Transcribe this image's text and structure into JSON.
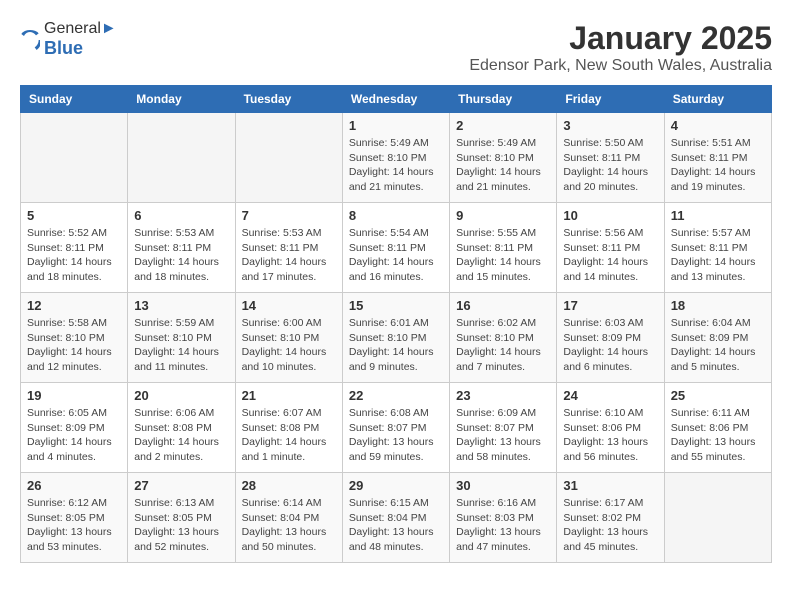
{
  "header": {
    "logo_general": "General",
    "logo_blue": "Blue",
    "month": "January 2025",
    "location": "Edensor Park, New South Wales, Australia"
  },
  "weekdays": [
    "Sunday",
    "Monday",
    "Tuesday",
    "Wednesday",
    "Thursday",
    "Friday",
    "Saturday"
  ],
  "weeks": [
    [
      {
        "day": "",
        "info": ""
      },
      {
        "day": "",
        "info": ""
      },
      {
        "day": "",
        "info": ""
      },
      {
        "day": "1",
        "info": "Sunrise: 5:49 AM\nSunset: 8:10 PM\nDaylight: 14 hours and 21 minutes."
      },
      {
        "day": "2",
        "info": "Sunrise: 5:49 AM\nSunset: 8:10 PM\nDaylight: 14 hours and 21 minutes."
      },
      {
        "day": "3",
        "info": "Sunrise: 5:50 AM\nSunset: 8:11 PM\nDaylight: 14 hours and 20 minutes."
      },
      {
        "day": "4",
        "info": "Sunrise: 5:51 AM\nSunset: 8:11 PM\nDaylight: 14 hours and 19 minutes."
      }
    ],
    [
      {
        "day": "5",
        "info": "Sunrise: 5:52 AM\nSunset: 8:11 PM\nDaylight: 14 hours and 18 minutes."
      },
      {
        "day": "6",
        "info": "Sunrise: 5:53 AM\nSunset: 8:11 PM\nDaylight: 14 hours and 18 minutes."
      },
      {
        "day": "7",
        "info": "Sunrise: 5:53 AM\nSunset: 8:11 PM\nDaylight: 14 hours and 17 minutes."
      },
      {
        "day": "8",
        "info": "Sunrise: 5:54 AM\nSunset: 8:11 PM\nDaylight: 14 hours and 16 minutes."
      },
      {
        "day": "9",
        "info": "Sunrise: 5:55 AM\nSunset: 8:11 PM\nDaylight: 14 hours and 15 minutes."
      },
      {
        "day": "10",
        "info": "Sunrise: 5:56 AM\nSunset: 8:11 PM\nDaylight: 14 hours and 14 minutes."
      },
      {
        "day": "11",
        "info": "Sunrise: 5:57 AM\nSunset: 8:11 PM\nDaylight: 14 hours and 13 minutes."
      }
    ],
    [
      {
        "day": "12",
        "info": "Sunrise: 5:58 AM\nSunset: 8:10 PM\nDaylight: 14 hours and 12 minutes."
      },
      {
        "day": "13",
        "info": "Sunrise: 5:59 AM\nSunset: 8:10 PM\nDaylight: 14 hours and 11 minutes."
      },
      {
        "day": "14",
        "info": "Sunrise: 6:00 AM\nSunset: 8:10 PM\nDaylight: 14 hours and 10 minutes."
      },
      {
        "day": "15",
        "info": "Sunrise: 6:01 AM\nSunset: 8:10 PM\nDaylight: 14 hours and 9 minutes."
      },
      {
        "day": "16",
        "info": "Sunrise: 6:02 AM\nSunset: 8:10 PM\nDaylight: 14 hours and 7 minutes."
      },
      {
        "day": "17",
        "info": "Sunrise: 6:03 AM\nSunset: 8:09 PM\nDaylight: 14 hours and 6 minutes."
      },
      {
        "day": "18",
        "info": "Sunrise: 6:04 AM\nSunset: 8:09 PM\nDaylight: 14 hours and 5 minutes."
      }
    ],
    [
      {
        "day": "19",
        "info": "Sunrise: 6:05 AM\nSunset: 8:09 PM\nDaylight: 14 hours and 4 minutes."
      },
      {
        "day": "20",
        "info": "Sunrise: 6:06 AM\nSunset: 8:08 PM\nDaylight: 14 hours and 2 minutes."
      },
      {
        "day": "21",
        "info": "Sunrise: 6:07 AM\nSunset: 8:08 PM\nDaylight: 14 hours and 1 minute."
      },
      {
        "day": "22",
        "info": "Sunrise: 6:08 AM\nSunset: 8:07 PM\nDaylight: 13 hours and 59 minutes."
      },
      {
        "day": "23",
        "info": "Sunrise: 6:09 AM\nSunset: 8:07 PM\nDaylight: 13 hours and 58 minutes."
      },
      {
        "day": "24",
        "info": "Sunrise: 6:10 AM\nSunset: 8:06 PM\nDaylight: 13 hours and 56 minutes."
      },
      {
        "day": "25",
        "info": "Sunrise: 6:11 AM\nSunset: 8:06 PM\nDaylight: 13 hours and 55 minutes."
      }
    ],
    [
      {
        "day": "26",
        "info": "Sunrise: 6:12 AM\nSunset: 8:05 PM\nDaylight: 13 hours and 53 minutes."
      },
      {
        "day": "27",
        "info": "Sunrise: 6:13 AM\nSunset: 8:05 PM\nDaylight: 13 hours and 52 minutes."
      },
      {
        "day": "28",
        "info": "Sunrise: 6:14 AM\nSunset: 8:04 PM\nDaylight: 13 hours and 50 minutes."
      },
      {
        "day": "29",
        "info": "Sunrise: 6:15 AM\nSunset: 8:04 PM\nDaylight: 13 hours and 48 minutes."
      },
      {
        "day": "30",
        "info": "Sunrise: 6:16 AM\nSunset: 8:03 PM\nDaylight: 13 hours and 47 minutes."
      },
      {
        "day": "31",
        "info": "Sunrise: 6:17 AM\nSunset: 8:02 PM\nDaylight: 13 hours and 45 minutes."
      },
      {
        "day": "",
        "info": ""
      }
    ]
  ]
}
